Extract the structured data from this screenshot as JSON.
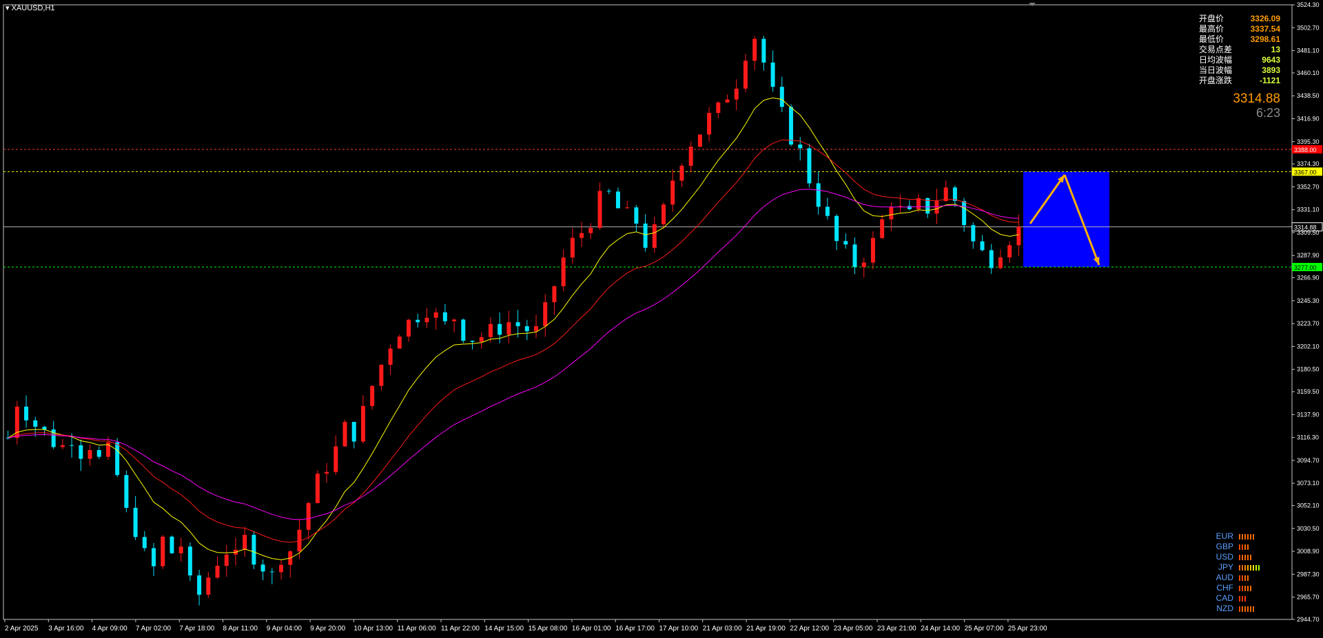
{
  "header": {
    "symbol": "XAUUSD,H1",
    "menu_icon": "triangle-down-icon"
  },
  "info_panel": {
    "rows": [
      {
        "label": "开盘价",
        "value": "3326.09"
      },
      {
        "label": "最高价",
        "value": "3337.54"
      },
      {
        "label": "最低价",
        "value": "3298.61"
      },
      {
        "label": "交易点差",
        "value": "13"
      },
      {
        "label": "日均波幅",
        "value": "9643"
      },
      {
        "label": "当日波幅",
        "value": "3893"
      },
      {
        "label": "开盘涨跌",
        "value": "-1121"
      }
    ],
    "current_price": "3314.88",
    "bar_timer": "6:23"
  },
  "currency_strength": [
    {
      "name": "EUR",
      "bars": [
        "#ff6a00",
        "#ff6a00",
        "#ff6a00",
        "#ff6a00",
        "#ff6a00",
        "#ff6a00"
      ]
    },
    {
      "name": "GBP",
      "bars": [
        "#ff4a00",
        "#ff4a00",
        "#ff6a00",
        "#ff6a00"
      ]
    },
    {
      "name": "USD",
      "bars": [
        "#ff4a00",
        "#ff6a00",
        "#ff6a00",
        "#ff6a00",
        "#ff6a00"
      ]
    },
    {
      "name": "JPY",
      "bars": [
        "#ff6a00",
        "#ff6a00",
        "#ff8a00",
        "#ffaa00",
        "#ffcc00",
        "#ffee00",
        "#c8ff00",
        "#a0ff00"
      ]
    },
    {
      "name": "AUD",
      "bars": [
        "#ff4a00",
        "#ff4a00",
        "#ff6a00",
        "#ff6a00"
      ]
    },
    {
      "name": "CHF",
      "bars": [
        "#ff4a00",
        "#ff4a00",
        "#ff6a00",
        "#ff6a00",
        "#ff6a00"
      ]
    },
    {
      "name": "CAD",
      "bars": [
        "#ff3a00",
        "#ff3a00",
        "#ff3a00"
      ]
    },
    {
      "name": "NZD",
      "bars": [
        "#ff4a00",
        "#ff6a00",
        "#ff6a00",
        "#ff6a00",
        "#ff6a00",
        "#ff6a00"
      ]
    }
  ],
  "chart_data": {
    "type": "candlestick",
    "symbol": "XAUUSD",
    "timeframe": "H1",
    "ylim": [
      2944.7,
      3524.3
    ],
    "y_ticks": [
      "3524.30",
      "3502.70",
      "3481.10",
      "3460.10",
      "3438.50",
      "3416.90",
      "3395.30",
      "3374.30",
      "3352.70",
      "3331.10",
      "3309.50",
      "3287.90",
      "3266.90",
      "3245.30",
      "3223.70",
      "3202.10",
      "3180.50",
      "3159.50",
      "3137.90",
      "3116.30",
      "3094.70",
      "3073.10",
      "3052.10",
      "3030.50",
      "3008.90",
      "2987.30",
      "2965.70",
      "2944.70"
    ],
    "x_labels": [
      "2 Apr 2025",
      "3 Apr 16:00",
      "4 Apr 09:00",
      "7 Apr 02:00",
      "7 Apr 18:00",
      "8 Apr 11:00",
      "9 Apr 04:00",
      "9 Apr 20:00",
      "10 Apr 13:00",
      "11 Apr 06:00",
      "11 Apr 22:00",
      "14 Apr 15:00",
      "15 Apr 08:00",
      "16 Apr 01:00",
      "16 Apr 17:00",
      "17 Apr 10:00",
      "21 Apr 03:00",
      "21 Apr 19:00",
      "22 Apr 12:00",
      "23 Apr 05:00",
      "23 Apr 21:00",
      "24 Apr 14:00",
      "25 Apr 07:00",
      "25 Apr 23:00"
    ],
    "price_path": [
      [
        0,
        3116
      ],
      [
        1,
        3150
      ],
      [
        2,
        3140
      ],
      [
        3,
        3128
      ],
      [
        4,
        3121
      ],
      [
        5,
        3112
      ],
      [
        6,
        3108
      ],
      [
        7,
        3117
      ],
      [
        8,
        3103
      ],
      [
        9,
        3110
      ],
      [
        10,
        3095
      ],
      [
        11,
        3103
      ],
      [
        12,
        3080
      ],
      [
        13,
        3045
      ],
      [
        14,
        3030
      ],
      [
        15,
        3005
      ],
      [
        16,
        2993
      ],
      [
        17,
        3020
      ],
      [
        18,
        3008
      ],
      [
        19,
        3015
      ],
      [
        20,
        2978
      ],
      [
        21,
        2968
      ],
      [
        22,
        2985
      ],
      [
        23,
        3000
      ],
      [
        24,
        3010
      ],
      [
        25,
        3002
      ],
      [
        26,
        3020
      ],
      [
        27,
        3005
      ],
      [
        28,
        2995
      ],
      [
        29,
        2985
      ],
      [
        30,
        3005
      ],
      [
        31,
        3010
      ],
      [
        32,
        3030
      ],
      [
        33,
        3055
      ],
      [
        34,
        3075
      ],
      [
        35,
        3090
      ],
      [
        36,
        3105
      ],
      [
        37,
        3125
      ],
      [
        38,
        3120
      ],
      [
        39,
        3140
      ],
      [
        40,
        3165
      ],
      [
        41,
        3185
      ],
      [
        42,
        3205
      ],
      [
        43,
        3218
      ],
      [
        44,
        3225
      ],
      [
        45,
        3232
      ],
      [
        46,
        3238
      ],
      [
        47,
        3230
      ],
      [
        48,
        3222
      ],
      [
        49,
        3230
      ],
      [
        50,
        3215
      ],
      [
        51,
        3210
      ],
      [
        52,
        3212
      ],
      [
        53,
        3216
      ],
      [
        54,
        3220
      ],
      [
        55,
        3225
      ],
      [
        56,
        3222
      ],
      [
        57,
        3218
      ],
      [
        58,
        3216
      ],
      [
        59,
        3235
      ],
      [
        60,
        3260
      ],
      [
        61,
        3285
      ],
      [
        62,
        3300
      ],
      [
        63,
        3310
      ],
      [
        64,
        3322
      ],
      [
        65,
        3340
      ],
      [
        66,
        3345
      ],
      [
        67,
        3332
      ],
      [
        68,
        3325
      ],
      [
        69,
        3320
      ],
      [
        70,
        3300
      ],
      [
        71,
        3310
      ],
      [
        72,
        3330
      ],
      [
        73,
        3360
      ],
      [
        74,
        3380
      ],
      [
        75,
        3395
      ],
      [
        76,
        3405
      ],
      [
        77,
        3418
      ],
      [
        78,
        3425
      ],
      [
        79,
        3440
      ],
      [
        80,
        3452
      ],
      [
        81,
        3480
      ],
      [
        82,
        3495
      ],
      [
        83,
        3470
      ],
      [
        84,
        3440
      ],
      [
        85,
        3420
      ],
      [
        86,
        3400
      ],
      [
        87,
        3385
      ],
      [
        88,
        3360
      ],
      [
        89,
        3340
      ],
      [
        90,
        3320
      ],
      [
        91,
        3300
      ],
      [
        92,
        3290
      ],
      [
        93,
        3280
      ],
      [
        94,
        3288
      ],
      [
        95,
        3300
      ],
      [
        96,
        3320
      ],
      [
        97,
        3340
      ],
      [
        98,
        3330
      ],
      [
        99,
        3325
      ],
      [
        100,
        3335
      ],
      [
        101,
        3332
      ],
      [
        102,
        3342
      ],
      [
        103,
        3350
      ],
      [
        104,
        3340
      ],
      [
        105,
        3320
      ],
      [
        106,
        3300
      ],
      [
        107,
        3290
      ],
      [
        108,
        3285
      ],
      [
        109,
        3295
      ],
      [
        110,
        3305
      ],
      [
        111,
        3312
      ]
    ],
    "moving_averages": [
      {
        "name": "",
        "color": "#ffff00"
      },
      {
        "name": "",
        "color": "#ff1a1a"
      },
      {
        "name": "",
        "color": "#ff00ff"
      }
    ],
    "horizontal_levels": [
      {
        "price": 3388.0,
        "label": "3388.00",
        "color": "#ff3b3b",
        "label_bg": "#ff0000",
        "style": "dashed"
      },
      {
        "price": 3367.0,
        "label": "3367.00",
        "color": "#ffff00",
        "label_bg": "#ffff00",
        "style": "dashed"
      },
      {
        "price": 3314.88,
        "label": "3314.88",
        "color": "#b4b4b4",
        "label_bg": "#000000",
        "style": "solid"
      },
      {
        "price": 3277.0,
        "label": "3277.00",
        "color": "#00ff00",
        "label_bg": "#00ff00",
        "style": "dashed"
      }
    ],
    "forecast_box": {
      "price_high": 3367.0,
      "price_low": 3277.0,
      "color": "#0000ff"
    },
    "forecast_arrows": [
      {
        "from_price": 3318.0,
        "to_price": 3364.0,
        "color": "#ffb000"
      },
      {
        "from_price": 3364.0,
        "to_price": 3279.0,
        "color": "#ffb000"
      }
    ]
  }
}
